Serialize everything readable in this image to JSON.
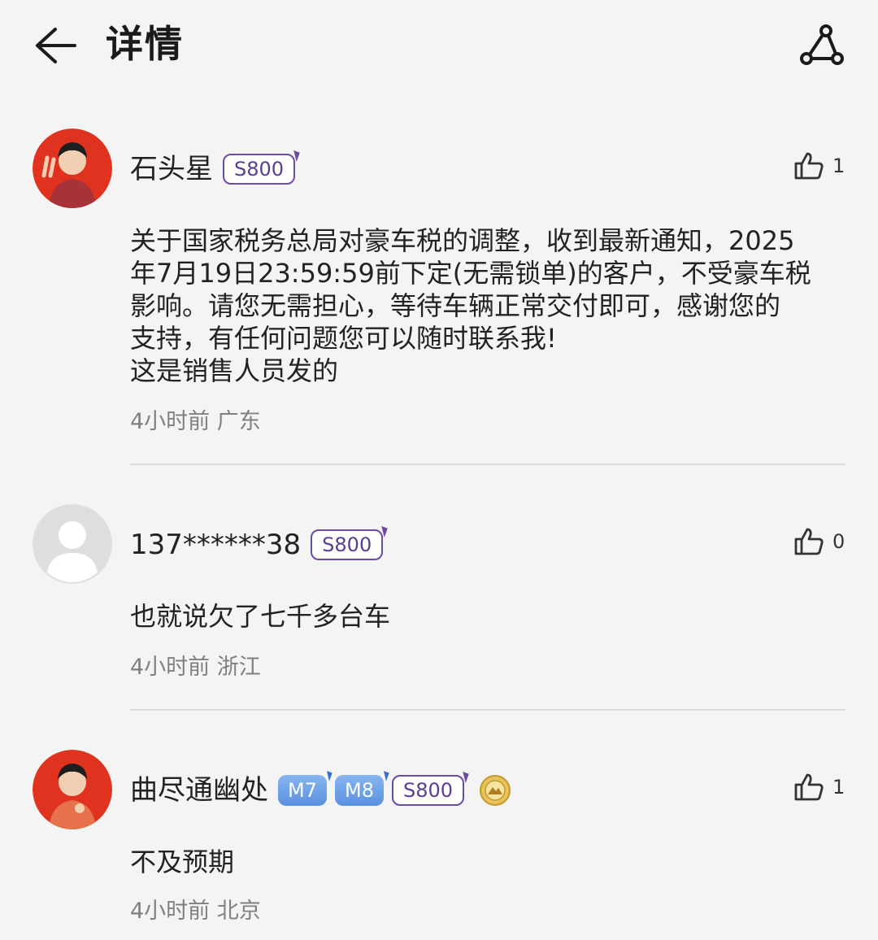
{
  "header": {
    "title": "详情"
  },
  "comments": [
    {
      "username": "石头星",
      "badges": [
        "S800"
      ],
      "likes": "1",
      "text_lines": [
        "关于国家税务总局对豪车税的调整，收到最新通知，2025",
        "年7月19日23:59:59前下定(无需锁单)的客户，不受豪车税",
        "影响。请您无需担心，等待车辆正常交付即可，感谢您的",
        "支持，有任何问题您可以随时联系我!",
        "这是销售人员发的"
      ],
      "time": "4小时前",
      "location": "广东"
    },
    {
      "username": "137******38",
      "badges": [
        "S800"
      ],
      "likes": "0",
      "text_lines": [
        "也就说欠了七千多台车"
      ],
      "time": "4小时前",
      "location": "浙江"
    },
    {
      "username": "曲尽通幽处",
      "badges": [
        "M7",
        "M8",
        "S800"
      ],
      "likes": "1",
      "text_lines": [
        "不及预期"
      ],
      "time": "4小时前",
      "location": "北京"
    }
  ],
  "colors": {
    "accent_purple": "#6c4ba3",
    "badge_blue": "#5a90df",
    "avatar_red": "#e0331f",
    "background": "#f4f4f4"
  },
  "icons": [
    "back-arrow-icon",
    "share-icon",
    "thumbs-up-icon",
    "medal-icon"
  ]
}
